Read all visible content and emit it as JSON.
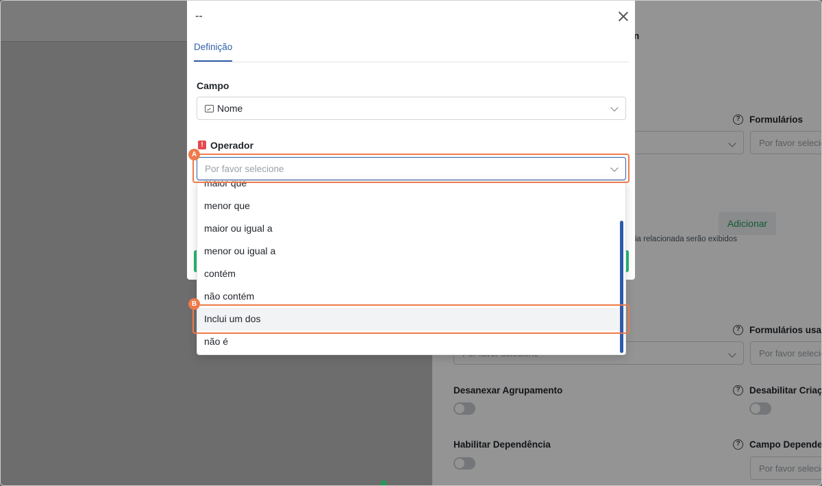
{
  "modal": {
    "title": "--",
    "tabs": [
      {
        "label": "Definição",
        "active": true
      }
    ],
    "campo": {
      "label": "Campo",
      "value": "Nome",
      "icon": "text-field-icon"
    },
    "operador": {
      "label": "Operador",
      "required_mark": "!",
      "placeholder": "Por favor selecione"
    },
    "dropdown": {
      "options": [
        {
          "label": "maior que"
        },
        {
          "label": "menor que"
        },
        {
          "label": "maior ou igual a"
        },
        {
          "label": "menor ou igual a"
        },
        {
          "label": "contém"
        },
        {
          "label": "não contém"
        },
        {
          "label": "Inclui um dos",
          "hovered": true
        },
        {
          "label": "não é"
        }
      ]
    }
  },
  "annotations": {
    "a": "A",
    "b": "B"
  },
  "background_panel": {
    "heading_fragment": "n",
    "formularios_label": "Formulários",
    "placeholder": "Por favor selecione",
    "placeholder_truncated": "Por favor selecio",
    "add_button": "Adicionar",
    "hint_text": "ia relacionada serão exibidos",
    "formularios_usados_label": "Formulários usad",
    "desanexar_label": "Desanexar Agrupamento",
    "desabilitar_label": "Desabilitar Criaçã",
    "habilitar_label": "Habilitar Dependência",
    "campo_dependente_label": "Campo Depende"
  },
  "colors": {
    "accent": "#2f5fa7",
    "annotation": "#ee7a4a",
    "required": "#e5484d",
    "success": "#2bb673"
  }
}
